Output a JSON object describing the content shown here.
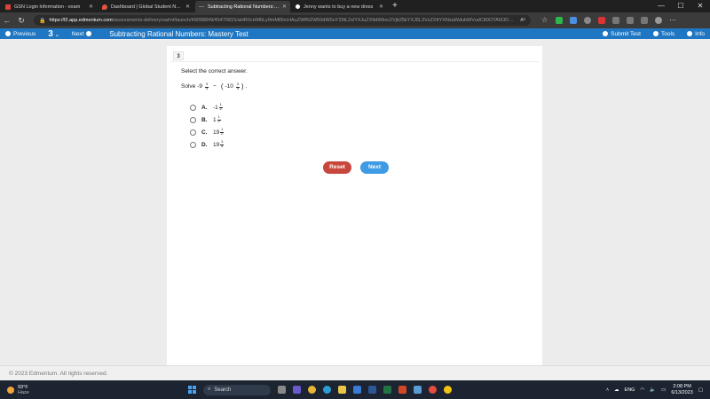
{
  "browser": {
    "tabs": [
      {
        "title": "GSN Login Information - exam",
        "active": false,
        "color": "#d9443a"
      },
      {
        "title": "Dashboard | Global Student Netw",
        "active": false,
        "color": "#e0533c"
      },
      {
        "title": "Subtracting Rational Numbers: M",
        "active": true,
        "color": "#7a7a7a"
      },
      {
        "title": "Jenny wants to buy a new dress",
        "active": false,
        "color": "#ffffff"
      }
    ],
    "new_tab": "+",
    "url_host": "https://f2.app.edmentum.com",
    "url_path": "/assessments-delivery/ua/mt/launch/49098849/45470815/aHR0cHM6Ly9mMi5hcHAuZWRtZW50dW0uY29tL2xlYXJuZXItdWkvc2Vjb25kYXJ5L3VzZXItYXNzaWdubWVudC80OTA5ODg0OQ",
    "reader": "Aʰ"
  },
  "appbar": {
    "previous": "Previous",
    "question_number": "3",
    "next": "Next",
    "title": "Subtracting Rational Numbers: Mastery Test",
    "submit": "Submit Test",
    "tools": "Tools",
    "info": "Info"
  },
  "question": {
    "badge": "3",
    "prompt": "Select the correct answer.",
    "solve_label": "Solve",
    "expr": {
      "a_whole": "-9",
      "a_num": "3",
      "a_den": "4",
      "op": "−",
      "b_whole": "-10",
      "b_num": "3",
      "b_den": "4"
    },
    "options": [
      {
        "letter": "A.",
        "whole": "-1",
        "num": "1",
        "den": "2"
      },
      {
        "letter": "B.",
        "whole": "1",
        "num": "1",
        "den": "2"
      },
      {
        "letter": "C.",
        "whole": "19",
        "num": "1",
        "den": "2"
      },
      {
        "letter": "D.",
        "whole": "19",
        "num": "3",
        "den": "4"
      }
    ],
    "reset": "Reset",
    "next": "Next"
  },
  "footer": {
    "copyright": "© 2023 Edmentum. All rights reserved."
  },
  "taskbar": {
    "temp": "93°F",
    "condition": "Haze",
    "search": "Search",
    "lang": "ENG",
    "time": "2:08 PM",
    "date": "6/13/2023"
  }
}
